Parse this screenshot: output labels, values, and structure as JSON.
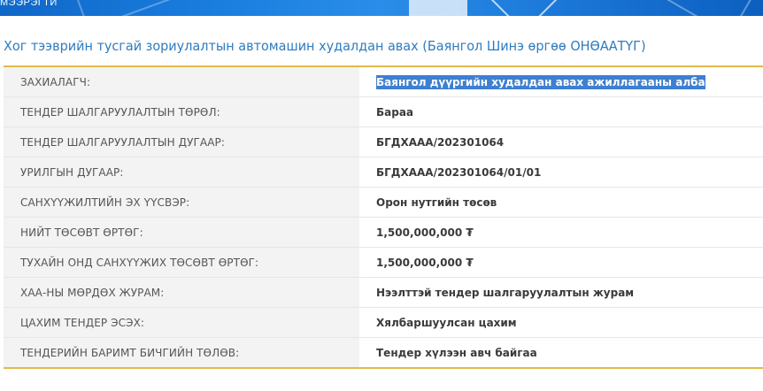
{
  "banner": {
    "text": "МЭЭРЭГТИ"
  },
  "page_title": "Хог тээврийн тусгай зориулалтын автомашин худалдан авах (Баянгол Шинэ өргөө ОНӨААТҮГ)",
  "rows": [
    {
      "label": "ЗАХИАЛАГЧ:",
      "value": "Баянгол дүүргийн худалдан авах ажиллагааны алба"
    },
    {
      "label": "ТЕНДЕР ШАЛГАРУУЛАЛТЫН ТӨРӨЛ:",
      "value": "Бараа"
    },
    {
      "label": "ТЕНДЕР ШАЛГАРУУЛАЛТЫН ДУГААР:",
      "value": "БГДХААА/202301064"
    },
    {
      "label": "УРИЛГЫН ДУГААР:",
      "value": "БГДХААА/202301064/01/01"
    },
    {
      "label": "САНХҮҮЖИЛТИЙН ЭХ ҮҮСВЭР:",
      "value": "Орон нутгийн төсөв"
    },
    {
      "label": "НИЙТ ТӨСӨВТ ӨРТӨГ:",
      "value": "1,500,000,000 ₮"
    },
    {
      "label": "ТУХАЙН ОНД САНХҮҮЖИХ ТӨСӨВТ ӨРТӨГ:",
      "value": "1,500,000,000 ₮"
    },
    {
      "label": "ХАА-НЫ МӨРДӨХ ЖУРАМ:",
      "value": "Нээлттэй тендер шалгаруулалтын журам"
    },
    {
      "label": "ЦАХИМ ТЕНДЕР ЭСЭХ:",
      "value": "Хялбаршуулсан цахим"
    },
    {
      "label": "ТЕНДЕРИЙН БАРИМТ БИЧГИЙН ТӨЛӨВ:",
      "value": "Тендер хүлээн авч байгаа"
    }
  ]
}
